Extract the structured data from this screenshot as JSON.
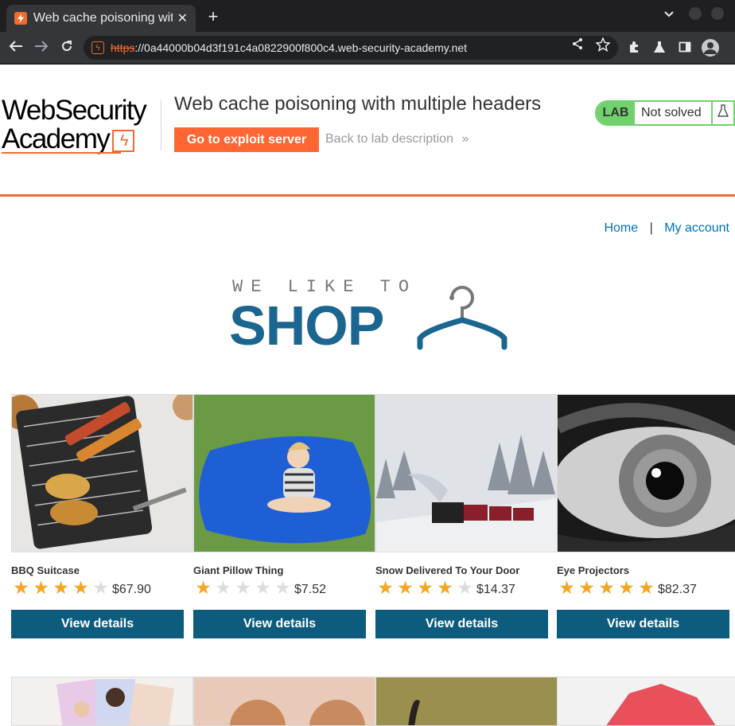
{
  "browser": {
    "tab_title": "Web cache poisoning with multiple headers",
    "tab_close": "✕",
    "new_tab": "+",
    "url_scheme": "https",
    "url_rest": "://0a44000b04d3f191c4a0822900f800c4.web-security-academy.net",
    "icons": [
      "back-icon",
      "forward-icon",
      "reload-icon",
      "share-icon",
      "star-icon",
      "extensions-icon",
      "labs-icon",
      "sidepanel-icon",
      "profile-icon"
    ]
  },
  "academy": {
    "logo_line1": "WebSecurity",
    "logo_line2": "Academy",
    "lab_title": "Web cache poisoning with multiple headers",
    "exploit_button": "Go to exploit server",
    "back_link": "Back to lab description",
    "back_chevrons": "»",
    "lab_badge": "LAB",
    "status": "Not solved"
  },
  "nav": {
    "home": "Home",
    "separator": "|",
    "account": "My account"
  },
  "banner": {
    "small": "WE LIKE TO",
    "big": "SHOP"
  },
  "colors": {
    "accent": "#f26b2d",
    "primary_button": "#0d5c7d",
    "banner_blue": "#1a6690",
    "star": "#f5a623",
    "status_green": "#70d16d"
  },
  "products": [
    {
      "name": "BBQ Suitcase",
      "price": "$67.90",
      "rating": 4,
      "button": "View details"
    },
    {
      "name": "Giant Pillow Thing",
      "price": "$7.52",
      "rating": 1,
      "button": "View details"
    },
    {
      "name": "Snow Delivered To Your Door",
      "price": "$14.37",
      "rating": 4,
      "button": "View details"
    },
    {
      "name": "Eye Projectors",
      "price": "$82.37",
      "rating": 5,
      "button": "View details"
    }
  ]
}
